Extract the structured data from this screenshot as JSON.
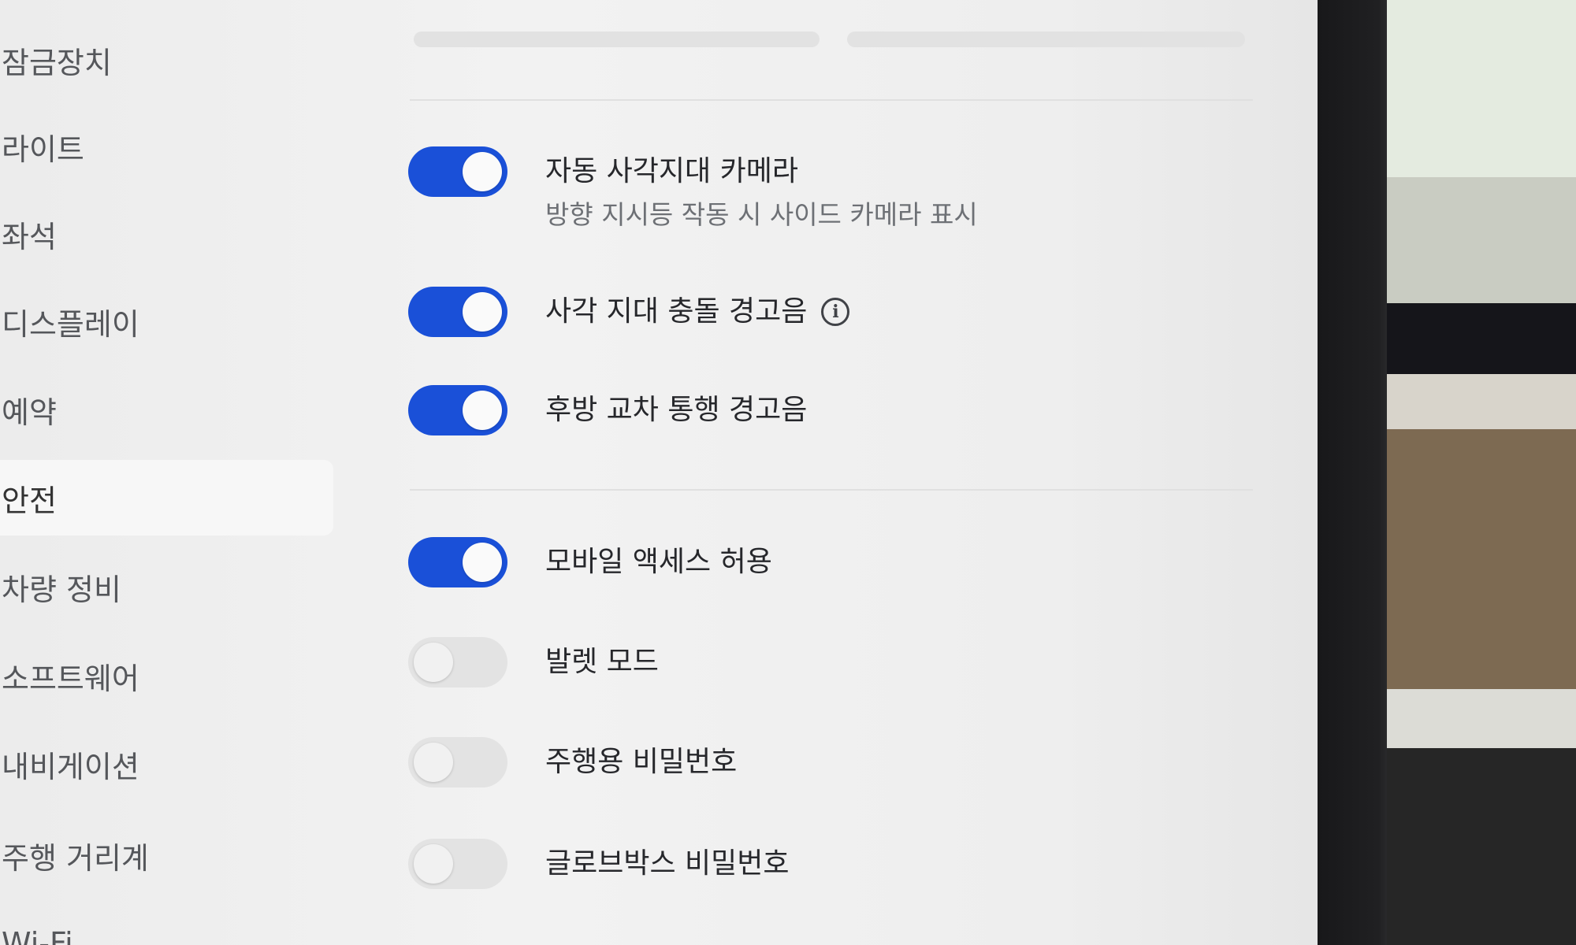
{
  "sidebar": {
    "items": [
      {
        "label": "잠금장치"
      },
      {
        "label": "라이트"
      },
      {
        "label": "좌석"
      },
      {
        "label": "디스플레이"
      },
      {
        "label": "예약"
      },
      {
        "label": "안전"
      },
      {
        "label": "차량 정비"
      },
      {
        "label": "소프트웨어"
      },
      {
        "label": "내비게이션"
      },
      {
        "label": "주행 거리계"
      },
      {
        "label": "Wi-Fi"
      }
    ],
    "active": "안전"
  },
  "settings": [
    {
      "label": "자동 사각지대 카메라",
      "description": "방향 지시등 작동 시 사이드 카메라 표시",
      "enabled": true
    },
    {
      "label": "사각 지대 충돌 경고음",
      "info_icon": "info-icon",
      "enabled": true
    },
    {
      "label": "후방 교차 통행 경고음",
      "enabled": true
    },
    {
      "label": "모바일 액세스 허용",
      "enabled": true
    },
    {
      "label": "발렛 모드",
      "enabled": false
    },
    {
      "label": "주행용 비밀번호",
      "enabled": false
    },
    {
      "label": "글로브박스 비밀번호",
      "enabled": false
    }
  ],
  "colors": {
    "toggle_on": "#1a50d8",
    "toggle_off": "#e3e3e3",
    "screen_bg": "#f0f0f0"
  }
}
